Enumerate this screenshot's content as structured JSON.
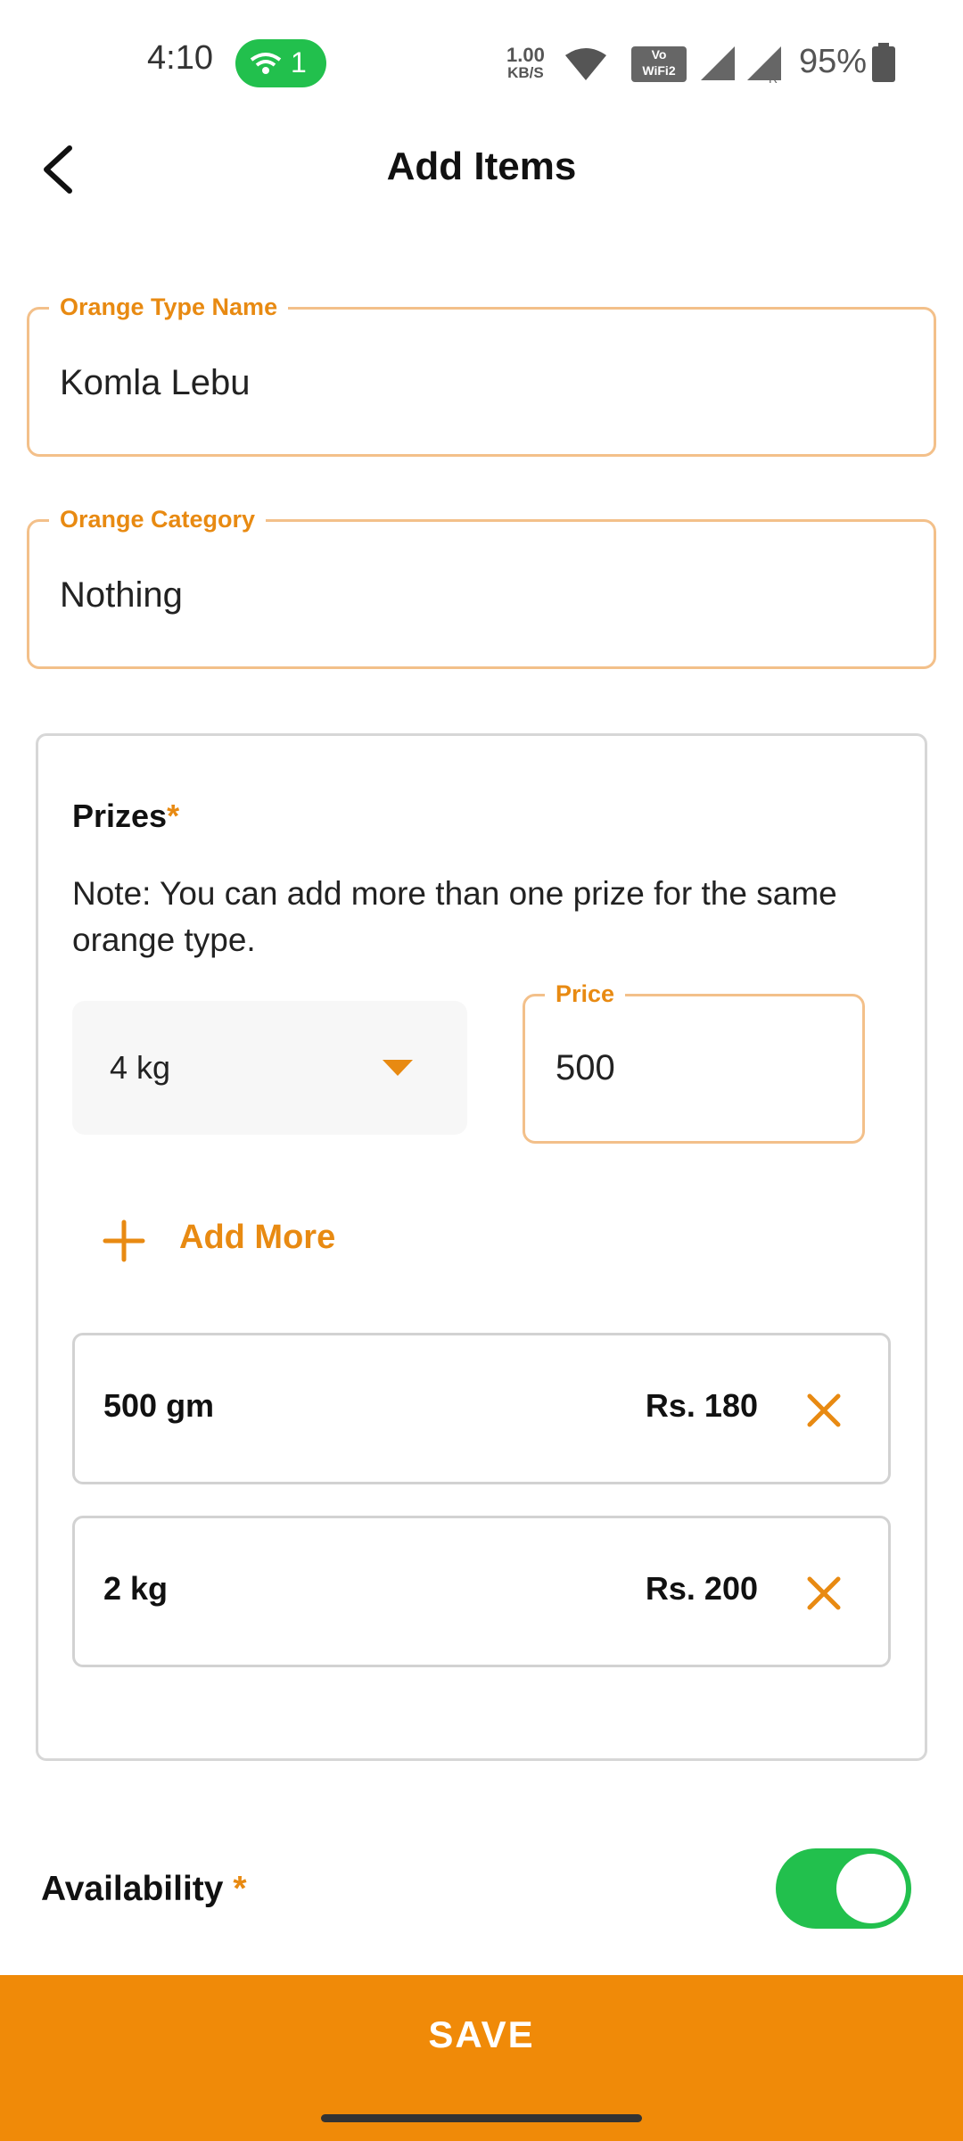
{
  "status_bar": {
    "time": "4:10",
    "hotspot_count": "1",
    "net_speed_value": "1.00",
    "net_speed_unit": "KB/S",
    "volte_label": "Vo",
    "wifi_calling_label": "WiFi2",
    "battery": "95%"
  },
  "header": {
    "title": "Add Items"
  },
  "form": {
    "name_label": "Orange Type Name",
    "name_value": "Komla Lebu",
    "category_label": "Orange Category",
    "category_value": "Nothing"
  },
  "prizes": {
    "title": "Prizes",
    "required_mark": "*",
    "note": "Note: You can add more than one prize for the same orange type.",
    "size_selected": "4 kg",
    "price_label": "Price",
    "price_value": "500",
    "add_more_label": "Add More",
    "items": [
      {
        "size": "500 gm",
        "price": "Rs. 180"
      },
      {
        "size": "2 kg",
        "price": "Rs. 200"
      }
    ]
  },
  "availability": {
    "label": "Availability",
    "required_mark": "*",
    "enabled": true
  },
  "save_label": "SAVE",
  "colors": {
    "accent": "#f08a08",
    "field_border": "#f3c08a",
    "toggle_on": "#22c04d"
  }
}
